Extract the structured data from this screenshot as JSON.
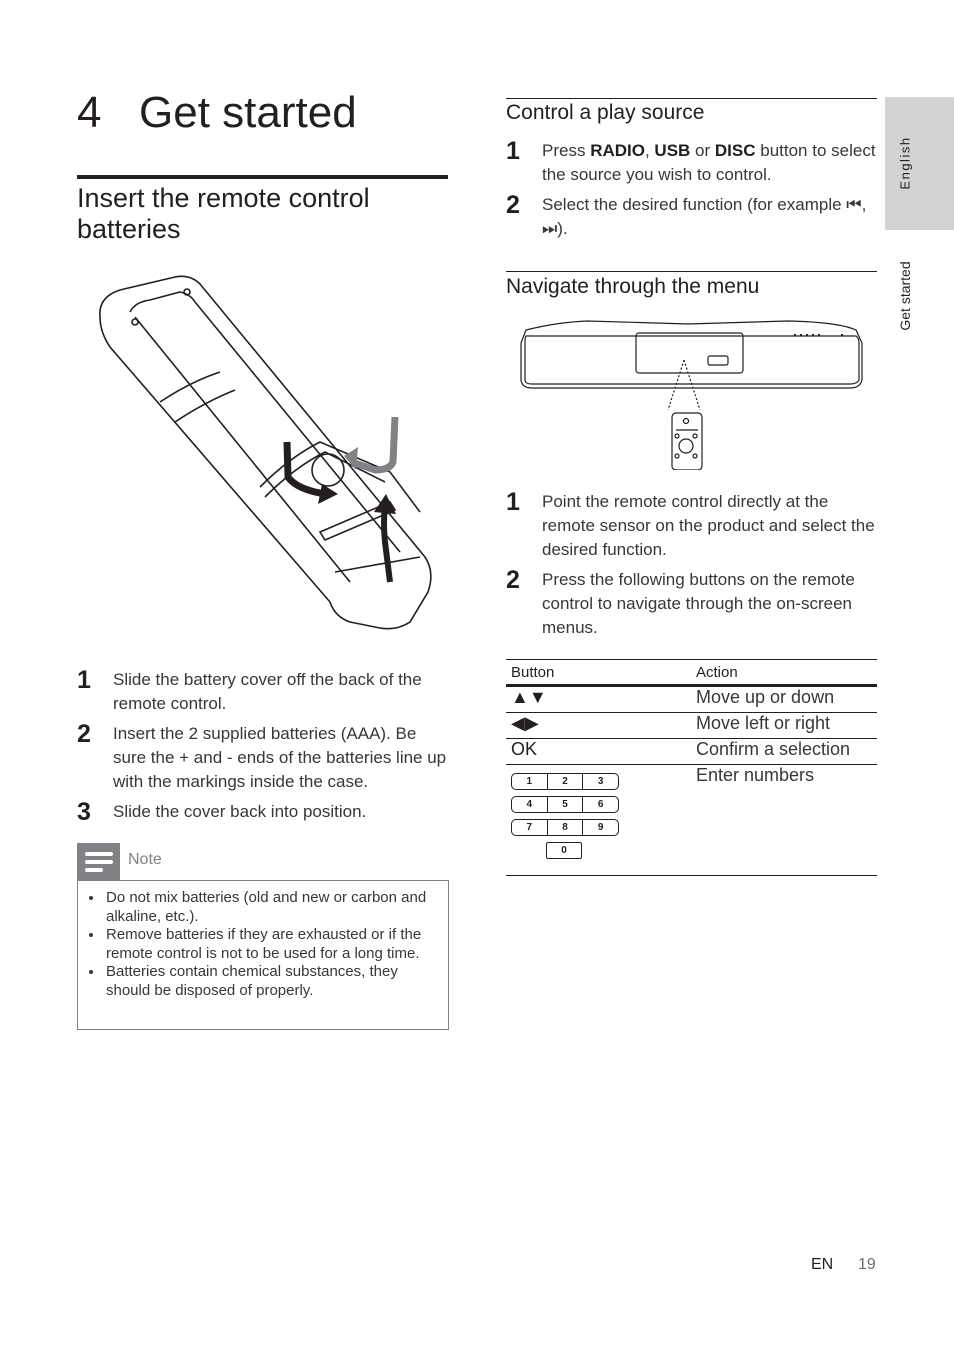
{
  "chapter": {
    "number": "4",
    "title": "Get started"
  },
  "side_tab": {
    "language": "English",
    "section": "Get started"
  },
  "left": {
    "section_title": "Insert the remote control batteries",
    "illustration": "remote-control-battery-insertion-illustration",
    "steps": [
      {
        "num": "1",
        "text": "Slide the battery cover off the back of the remote control."
      },
      {
        "num": "2",
        "text": "Insert the 2 supplied batteries (AAA). Be sure the + and - ends of the batteries line up with the markings inside the case."
      },
      {
        "num": "3",
        "text": "Slide the cover back into position."
      }
    ],
    "note": {
      "label": "Note",
      "items": [
        "Do not mix batteries (old and new or carbon and alkaline, etc.).",
        "Remove batteries if they are exhausted or if the remote control is not to be used for a long time.",
        "Batteries contain chemical substances, they should be disposed of properly."
      ]
    }
  },
  "right": {
    "control_source": {
      "title": "Control a play source",
      "steps": [
        {
          "num": "1",
          "pre": "Press ",
          "b1": "RADIO",
          "m1": ", ",
          "b2": "USB",
          "m2": " or ",
          "b3": "DISC",
          "post": " button to select the source you wish to control."
        },
        {
          "num": "2",
          "text": "Select the desired function (for example ⏮, ⏭)."
        }
      ]
    },
    "navigate_menu": {
      "title": "Navigate through the menu",
      "illustration": "soundbar-and-remote-illustration",
      "steps": [
        {
          "num": "1",
          "text": "Point the remote control directly at the remote sensor on the product and select the desired function."
        },
        {
          "num": "2",
          "text": "Press the following buttons on the remote control to navigate through the on-screen menus."
        }
      ]
    },
    "table": {
      "headers": [
        "Button",
        "Action"
      ],
      "rows": [
        {
          "button": "▲▼",
          "action": "Move up or down"
        },
        {
          "button": "◀▶",
          "action": "Move left or right"
        },
        {
          "button": "OK",
          "action": "Confirm a selection"
        },
        {
          "button": "numeric-keypad",
          "action": "Enter numbers"
        }
      ],
      "keypad": [
        [
          "1",
          "2",
          "3"
        ],
        [
          "4",
          "5",
          "6"
        ],
        [
          "7",
          "8",
          "9"
        ],
        [
          "0"
        ]
      ]
    }
  },
  "footer": {
    "lang": "EN",
    "page": "19"
  }
}
